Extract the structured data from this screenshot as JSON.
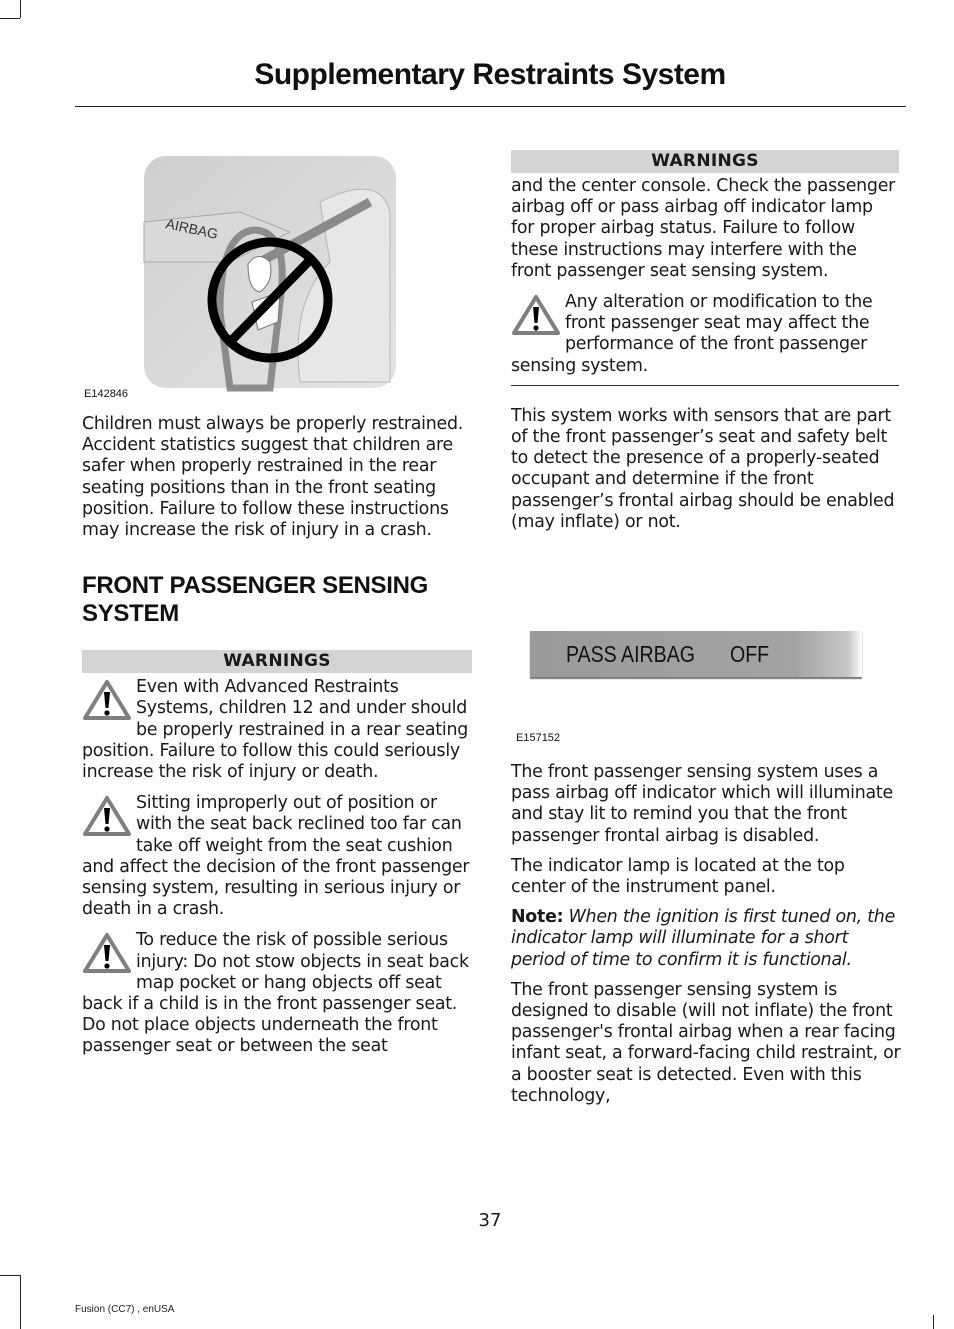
{
  "header": {
    "title": "Supplementary Restraints System"
  },
  "left_column": {
    "figure1": {
      "label": "E142846",
      "image_text": "AIRBAG",
      "description": "child-seat-in-front-seat-prohibited"
    },
    "intro_paragraph": "Children must always be properly restrained. Accident statistics suggest that children are safer when properly restrained in the rear seating positions than in the front seating position. Failure to follow these instructions may increase the risk of injury in a crash.",
    "section_heading": "FRONT PASSENGER SENSING SYSTEM",
    "warnings": {
      "heading": "WARNINGS",
      "items": [
        "Even with Advanced Restraints Systems, children 12 and under should be properly restrained in a rear seating position. Failure to follow this could seriously increase the risk of injury or death.",
        "Sitting improperly out of position or with the seat back reclined too far can take off weight from the seat cushion and affect the decision of the front passenger sensing system, resulting in serious injury or death in a crash.",
        "To reduce the risk of possible serious injury: Do not stow objects in seat back map pocket or hang objects off seat back if a child is in the front passenger seat. Do not place objects underneath the front passenger seat or between the seat"
      ]
    }
  },
  "right_column": {
    "warnings": {
      "heading": "WARNINGS",
      "continued_text": "and the center console. Check the passenger airbag off or pass airbag off indicator lamp for proper airbag status. Failure to follow these instructions may interfere with the front passenger seat sensing system.",
      "items": [
        "Any alteration or modification to the front passenger seat may affect the performance of the front passenger sensing system."
      ]
    },
    "paragraph1": "This system works with sensors that are part of the front passenger’s seat and safety belt to detect the presence of a properly-seated occupant and determine if the front passenger’s frontal airbag should be enabled (may inflate) or not.",
    "figure2": {
      "label": "E157152",
      "lamp_text_left": "PASS AIRBAG",
      "lamp_text_right": "OFF"
    },
    "paragraph2": "The front passenger sensing system uses a pass airbag off indicator which will illuminate and stay lit to remind you that the front passenger frontal airbag is disabled.",
    "paragraph3": "The indicator lamp is located at the top center of the instrument panel.",
    "note": {
      "label": "Note:",
      "text": " When the ignition is first tuned on, the indicator lamp will illuminate for a short period of time to confirm it is functional."
    },
    "paragraph4": "The front passenger sensing system is designed to disable (will not inflate) the front passenger's frontal airbag when a rear facing infant seat, a forward-facing child restraint, or a booster seat is detected. Even with this technology,"
  },
  "footer": {
    "page_number": "37",
    "document_id": "Fusion (CC7) , enUSA"
  }
}
